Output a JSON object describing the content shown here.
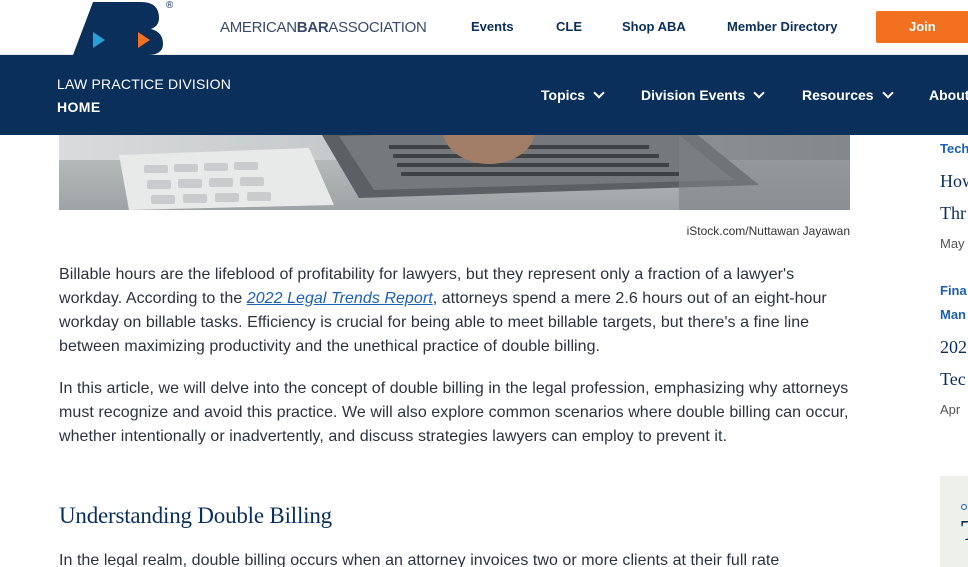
{
  "header": {
    "logo_text": "ABA",
    "wordmark_pre": "AMERICAN",
    "wordmark_bold": "BAR",
    "wordmark_post": "ASSOCIATION",
    "links": [
      "Events",
      "CLE",
      "Shop ABA",
      "Member Directory"
    ],
    "join_label": "Join"
  },
  "division_nav": {
    "division_name": "LAW PRACTICE DIVISION",
    "home_label": "HOME",
    "items": [
      "Topics",
      "Division Events",
      "Resources",
      "About"
    ]
  },
  "article": {
    "image_caption": "iStock.com/Nuttawan Jayawan",
    "p1_before": "Billable hours are the lifeblood of profitability for lawyers, but they represent only a fraction of a lawyer's workday. According to the ",
    "p1_link": "2022 Legal Trends Report",
    "p1_after": ", attorneys spend a mere 2.6 hours out of an eight-hour workday on billable tasks. Efficiency is crucial for being able to meet billable targets, but there's a fine line between maximizing productivity and the unethical practice of double billing.",
    "p2": "In this article, we will delve into the concept of double billing in the legal profession, emphasizing why attorneys must recognize and avoid this practice. We will also explore common scenarios where double billing can occur, whether intentionally or inadvertently, and discuss strategies lawyers can employ to prevent it.",
    "heading": "Understanding Double Billing",
    "p3": "In the legal realm, double billing occurs when an attorney invoices two or more clients at their full rate"
  },
  "sidebar": {
    "items": [
      {
        "category": "Tech",
        "title_line1": "How",
        "title_line2": "Thr",
        "date": "May"
      },
      {
        "category": "Fina",
        "category_line2": "Man",
        "title_line1": "202",
        "title_line2": "Tec",
        "date": "Apr"
      }
    ],
    "ad_letter": "T"
  },
  "colors": {
    "navy": "#0b2f5b",
    "orange": "#f37021",
    "link_blue": "#1c5fb8"
  }
}
